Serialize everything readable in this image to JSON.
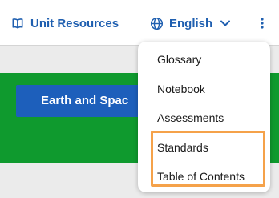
{
  "header": {
    "unit_resources_label": "Unit Resources",
    "language_label": "English",
    "icons": {
      "book": "book-open-icon",
      "globe": "globe-icon",
      "chevron": "chevron-down-icon",
      "more": "kebab-menu-icon"
    }
  },
  "banner": {
    "title": "Earth and Spac"
  },
  "menu": {
    "items": [
      {
        "label": "Glossary"
      },
      {
        "label": "Notebook"
      },
      {
        "label": "Assessments"
      },
      {
        "label": "Standards"
      },
      {
        "label": "Table of Contents"
      }
    ]
  },
  "colors": {
    "accent": "#1f5fb0",
    "banner_green": "#0f9a2e",
    "tab_blue": "#1d5fbb",
    "highlight_orange": "#f5a24a"
  }
}
